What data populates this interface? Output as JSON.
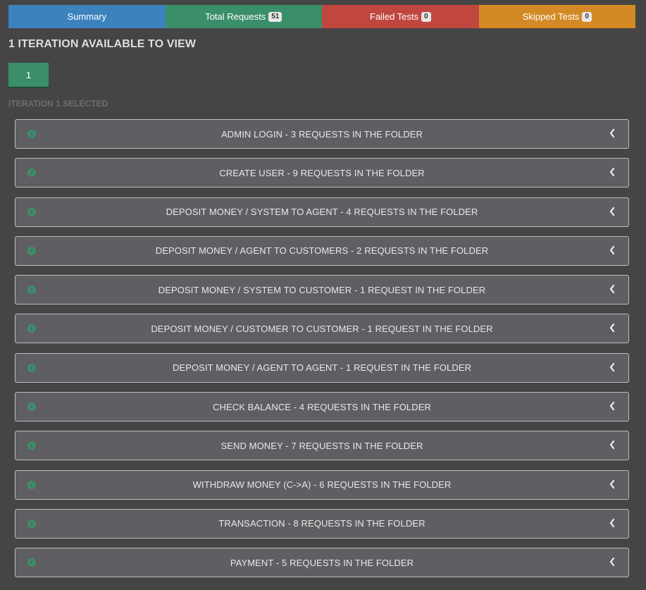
{
  "colors": {
    "summary": "#3c82bd",
    "total": "#3b8e6a",
    "failed": "#c0463f",
    "skipped": "#d38a24",
    "iteration": "#3b8e6a",
    "status_ok": "#3b8e6a"
  },
  "tabs": {
    "summary": {
      "label": "Summary"
    },
    "total": {
      "label": "Total Requests",
      "count": "51"
    },
    "failed": {
      "label": "Failed Tests",
      "count": "0"
    },
    "skipped": {
      "label": "Skipped Tests",
      "count": "0"
    }
  },
  "heading": "1 ITERATION AVAILABLE TO VIEW",
  "iteration": {
    "button": "1",
    "selected_text": "ITERATION 1 SELECTED"
  },
  "folders": [
    {
      "label": "ADMIN LOGIN - 3 REQUESTS IN THE FOLDER",
      "icon": "info-icon",
      "toggle_icon": "chevron-left-icon"
    },
    {
      "label": "CREATE USER - 9 REQUESTS IN THE FOLDER",
      "icon": "info-icon",
      "toggle_icon": "chevron-left-icon"
    },
    {
      "label": "DEPOSIT MONEY / SYSTEM TO AGENT - 4 REQUESTS IN THE FOLDER",
      "icon": "info-icon",
      "toggle_icon": "chevron-left-icon"
    },
    {
      "label": "DEPOSIT MONEY / AGENT TO CUSTOMERS - 2 REQUESTS IN THE FOLDER",
      "icon": "info-icon",
      "toggle_icon": "chevron-left-icon"
    },
    {
      "label": "DEPOSIT MONEY / SYSTEM TO CUSTOMER - 1 REQUEST IN THE FOLDER",
      "icon": "info-icon",
      "toggle_icon": "chevron-left-icon"
    },
    {
      "label": "DEPOSIT MONEY / CUSTOMER TO CUSTOMER - 1 REQUEST IN THE FOLDER",
      "icon": "info-icon",
      "toggle_icon": "chevron-left-icon"
    },
    {
      "label": "DEPOSIT MONEY / AGENT TO AGENT - 1 REQUEST IN THE FOLDER",
      "icon": "info-icon",
      "toggle_icon": "chevron-left-icon"
    },
    {
      "label": "CHECK BALANCE - 4 REQUESTS IN THE FOLDER",
      "icon": "info-icon",
      "toggle_icon": "chevron-left-icon"
    },
    {
      "label": "SEND MONEY - 7 REQUESTS IN THE FOLDER",
      "icon": "info-icon",
      "toggle_icon": "chevron-left-icon"
    },
    {
      "label": "WITHDRAW MONEY (C->A) - 6 REQUESTS IN THE FOLDER",
      "icon": "info-icon",
      "toggle_icon": "chevron-left-icon"
    },
    {
      "label": "TRANSACTION - 8 REQUESTS IN THE FOLDER",
      "icon": "info-icon",
      "toggle_icon": "chevron-left-icon"
    },
    {
      "label": "PAYMENT - 5 REQUESTS IN THE FOLDER",
      "icon": "info-icon",
      "toggle_icon": "chevron-left-icon"
    }
  ]
}
